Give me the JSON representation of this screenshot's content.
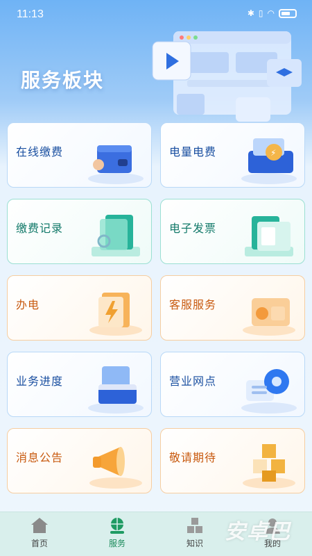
{
  "status_bar": {
    "time": "11:13",
    "icons": [
      "bluetooth-icon",
      "vibrate-icon",
      "wifi-icon",
      "battery-icon"
    ]
  },
  "hero": {
    "title": "服务板块"
  },
  "cards": [
    {
      "label": "在线缴费",
      "icon": "wallet-icon",
      "theme": "blue"
    },
    {
      "label": "电量电费",
      "icon": "coin-box-icon",
      "theme": "blue"
    },
    {
      "label": "缴费记录",
      "icon": "records-icon",
      "theme": "teal"
    },
    {
      "label": "电子发票",
      "icon": "invoice-folder-icon",
      "theme": "teal"
    },
    {
      "label": "办电",
      "icon": "lightning-icon",
      "theme": "orange"
    },
    {
      "label": "客服服务",
      "icon": "customer-service-icon",
      "theme": "orange"
    },
    {
      "label": "业务进度",
      "icon": "progress-box-icon",
      "theme": "blue"
    },
    {
      "label": "营业网点",
      "icon": "location-pin-icon",
      "theme": "blue"
    },
    {
      "label": "消息公告",
      "icon": "megaphone-icon",
      "theme": "orange"
    },
    {
      "label": "敬请期待",
      "icon": "cubes-icon",
      "theme": "orange"
    }
  ],
  "tabbar": {
    "tabs": [
      {
        "label": "首页",
        "icon": "home-icon",
        "active": false
      },
      {
        "label": "服务",
        "icon": "globe-hand-icon",
        "active": true
      },
      {
        "label": "知识",
        "icon": "cubes-knowledge-icon",
        "active": false
      },
      {
        "label": "我的",
        "icon": "user-icon",
        "active": false
      }
    ]
  },
  "colors": {
    "primary_blue": "#1a4fa0",
    "teal": "#137a6a",
    "orange": "#c85a10",
    "tab_active": "#1a8a5a"
  },
  "watermark": "安卓巴"
}
